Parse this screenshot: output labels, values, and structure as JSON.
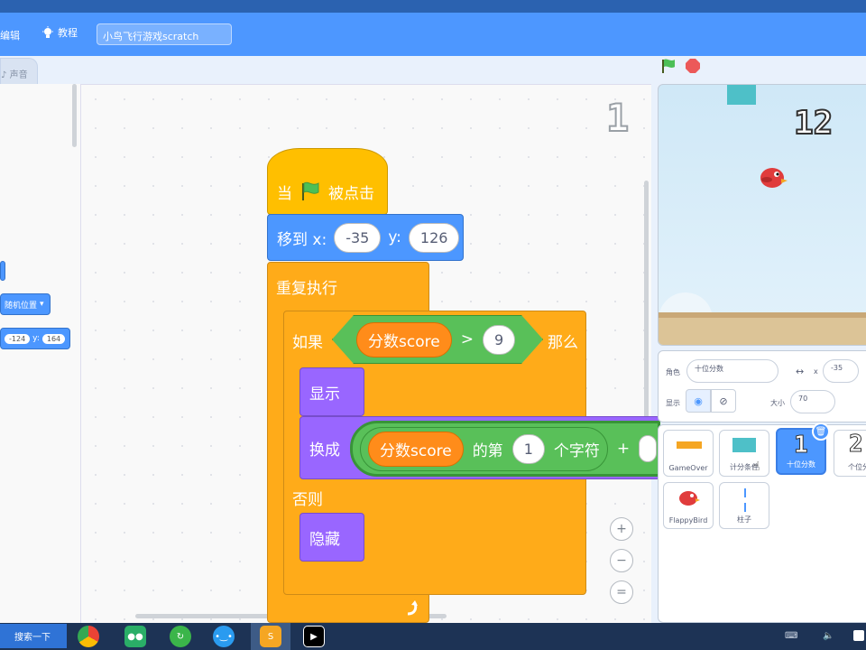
{
  "menu": {
    "edit": "编辑",
    "tutorials": "教程",
    "project_title": "小鸟飞行游戏scratch"
  },
  "tabs": {
    "sound": "声音"
  },
  "palette": {
    "random_position": "随机位置",
    "goto_x": "-124",
    "goto_y_label": "y:",
    "goto_y": "164"
  },
  "script_area": {
    "costume_number": "1"
  },
  "blocks": {
    "when_flag_pre": "当",
    "when_flag_post": "被点击",
    "goto_label": "移到 x:",
    "goto_x": "-35",
    "goto_y_label": "y:",
    "goto_y": "126",
    "forever": "重复执行",
    "if_label": "如果",
    "then_label": "那么",
    "var_score": "分数score",
    "gt_symbol": ">",
    "compare_value": "9",
    "show": "显示",
    "switch_costume": "换成",
    "letter_of_mid": "的第",
    "letter_index": "1",
    "letter_suffix": "个字符",
    "plus_symbol": "+",
    "else_label": "否则",
    "hide": "隐藏"
  },
  "zoom": {
    "in": "+",
    "out": "−",
    "reset": "="
  },
  "stage": {
    "score_display": "12"
  },
  "sprite_info": {
    "sprite_label": "角色",
    "sprite_name": "十位分数",
    "x_label": "x",
    "x_value": "-35",
    "show_label": "显示",
    "size_label": "大小",
    "size_value": "70"
  },
  "sprites": [
    {
      "name": "GameOver"
    },
    {
      "name": "计分条件"
    },
    {
      "name": "十位分数"
    },
    {
      "name": "个位分"
    },
    {
      "name": "FlappyBird"
    },
    {
      "name": "柱子"
    }
  ],
  "taskbar": {
    "search": "搜索一下"
  },
  "colors": {
    "menu_blue": "#4d97ff",
    "events": "#ffbf00",
    "motion": "#4c97ff",
    "control": "#ffab19",
    "looks": "#9966ff",
    "operators": "#59c059",
    "variables": "#ff8c1a"
  }
}
